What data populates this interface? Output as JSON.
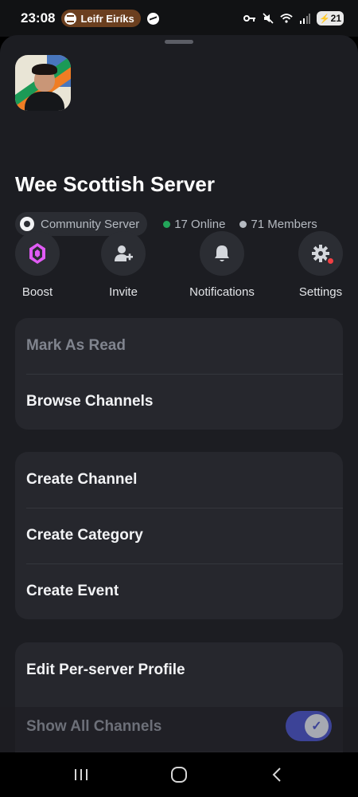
{
  "status_bar": {
    "time": "23:08",
    "media_pill": "Leifr Eiríks",
    "battery": "21",
    "icons": [
      "spotify-icon",
      "messenger-icon",
      "key-icon",
      "mute-icon",
      "wifi-icon",
      "signal-icon",
      "battery-icon"
    ]
  },
  "server": {
    "name": "Wee Scottish Server",
    "badge": "Community Server",
    "online": "17 Online",
    "members": "71 Members",
    "online_color": "#23a55a",
    "members_color": "#b5bac1"
  },
  "actions": [
    {
      "label": "Boost",
      "icon": "boost-gem-icon"
    },
    {
      "label": "Invite",
      "icon": "add-user-icon"
    },
    {
      "label": "Notifications",
      "icon": "bell-icon"
    },
    {
      "label": "Settings",
      "icon": "gear-icon"
    }
  ],
  "menu": {
    "group1": [
      "Mark As Read",
      "Browse Channels"
    ],
    "group2": [
      "Create Channel",
      "Create Category",
      "Create Event"
    ],
    "group3": [
      "Edit Per-server Profile"
    ],
    "show_all_channels": "Show All Channels"
  },
  "nav": {
    "icons": [
      "recent-apps-icon",
      "home-icon",
      "back-icon"
    ]
  },
  "colors": {
    "accent": "#5865f2",
    "boost": "#e05bf4",
    "danger": "#f23f43"
  }
}
